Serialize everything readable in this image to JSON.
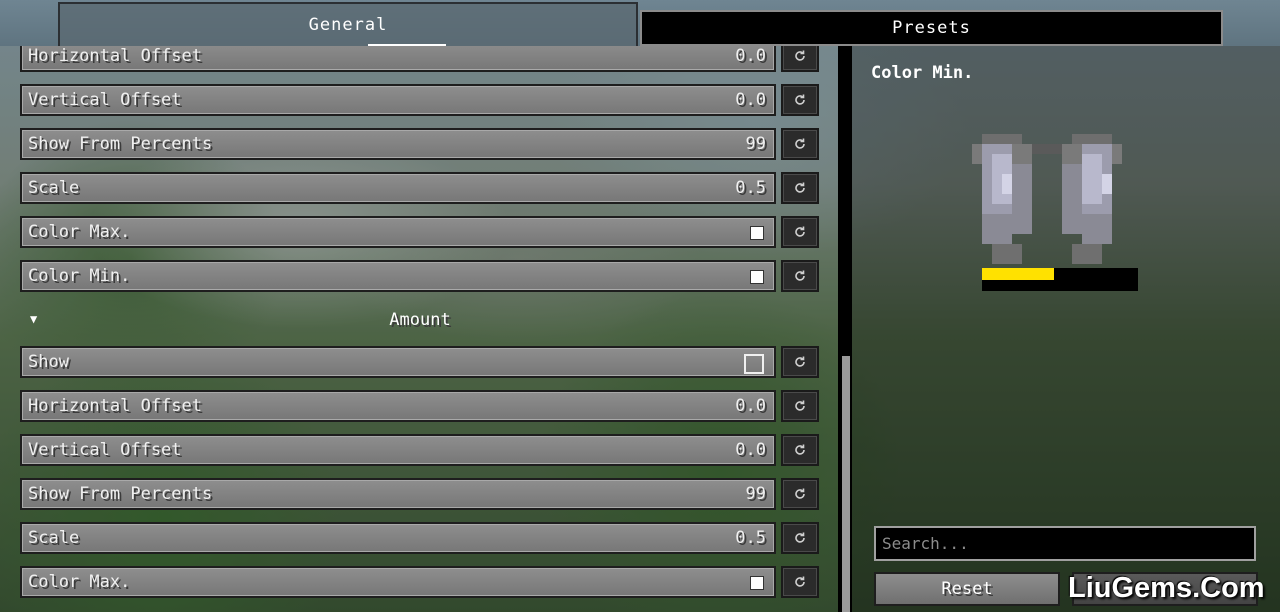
{
  "tabs": [
    {
      "label": "General",
      "active": true
    },
    {
      "label": "Presets",
      "active": false
    }
  ],
  "settings": {
    "rows_top": [
      {
        "label": "Horizontal Offset",
        "type": "number",
        "value": "0.0"
      },
      {
        "label": "Vertical Offset",
        "type": "number",
        "value": "0.0"
      },
      {
        "label": "Show From Percents",
        "type": "number",
        "value": "99"
      },
      {
        "label": "Scale",
        "type": "number",
        "value": "0.5"
      },
      {
        "label": "Color Max.",
        "type": "color",
        "value": "#ffffff"
      },
      {
        "label": "Color Min.",
        "type": "color",
        "value": "#ffffff"
      }
    ],
    "section": {
      "title": "Amount",
      "expanded": true
    },
    "rows_bottom": [
      {
        "label": "Show",
        "type": "checkbox",
        "checked": false
      },
      {
        "label": "Horizontal Offset",
        "type": "number",
        "value": "0.0"
      },
      {
        "label": "Vertical Offset",
        "type": "number",
        "value": "0.0"
      },
      {
        "label": "Show From Percents",
        "type": "number",
        "value": "99"
      },
      {
        "label": "Scale",
        "type": "number",
        "value": "0.5"
      },
      {
        "label": "Color Max.",
        "type": "color",
        "value": "#ffffff"
      }
    ],
    "reset_icon": "reset-icon"
  },
  "preview": {
    "title": "Color Min.",
    "icon": "elytra-icon",
    "bar_fill_fraction": 0.46,
    "bar_color": "#ffe100"
  },
  "search": {
    "placeholder": "Search..."
  },
  "buttons": {
    "reset_label": "Reset",
    "hidden_label": ""
  },
  "watermark": "LiuGems.Com"
}
